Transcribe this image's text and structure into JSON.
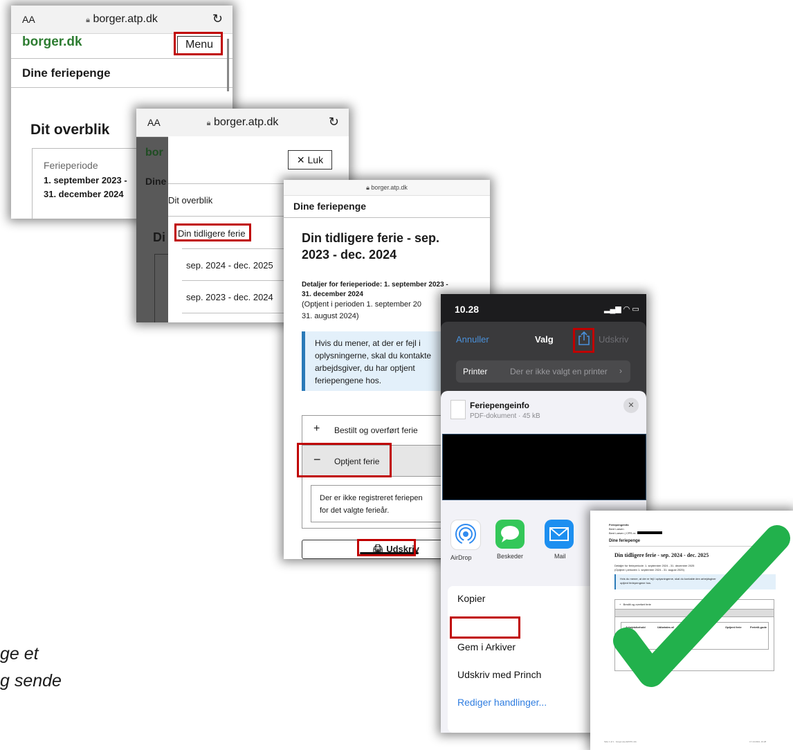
{
  "caption": {
    "line1": "ge et",
    "line2": "g sende"
  },
  "colors": {
    "highlight_border": "#c00000",
    "brand_green": "#2e7d32",
    "ios_blue": "#4a90d9",
    "check_green": "#22b14c",
    "info_blue": "#2a7ab8"
  },
  "screen1": {
    "aa": "AA",
    "host": "borger.atp.dk",
    "logo": "borger.dk",
    "menu_button": "Menu",
    "section_title": "Dine feriepenge",
    "overview_title": "Dit overblik",
    "period_label": "Ferieperiode",
    "period_line1": "1. september 2023 -",
    "period_line2": "31. december 2024"
  },
  "screen2": {
    "aa": "AA",
    "host": "borger.atp.dk",
    "bg_logo": "bor",
    "bg_nav": "Dine",
    "bg_heading": "Di",
    "close_button": "Luk",
    "menu_items": [
      "Dit overblik",
      "Din tidligere ferie",
      "sep. 2024 - dec. 2025",
      "sep. 2023 - dec. 2024"
    ]
  },
  "screen3": {
    "host": "borger.atp.dk",
    "section_title": "Dine feriepenge",
    "heading_line1": "Din tidligere ferie - sep.",
    "heading_line2": "2023 - dec. 2024",
    "details_line1": "Detaljer for ferieperiode: 1. september 2023 -",
    "details_line2": "31. december 2024",
    "earned_line1": "(Optjent i perioden 1. september 20",
    "earned_line2": "31. august 2024)",
    "info_lines": [
      "Hvis du mener, at der er fejl i",
      "oplysningerne, skal du kontakte",
      "arbejdsgiver, du har optjent",
      "feriepengene hos."
    ],
    "accordion1": "Bestilt og overført ferie",
    "accordion2": "Optjent ferie",
    "empty_line1": "Der er ikke registreret feriepen",
    "empty_line2": "for det valgte ferieår.",
    "print_button": "Udskriv"
  },
  "screen4": {
    "time": "10.28",
    "cancel": "Annuller",
    "title": "Valg",
    "print": "Udskriv",
    "printer_label": "Printer",
    "printer_value": "Der er ikke valgt en printer",
    "doc_title": "Feriepengeinfo",
    "doc_subtitle": "PDF-dokument · 45 kB",
    "apps": [
      "AirDrop",
      "Beskeder",
      "Mail"
    ],
    "actions": [
      "Kopier",
      "Gem i Arkiver",
      "Udskriv med Princh"
    ],
    "edit_actions": "Rediger handlinger..."
  },
  "screen5": {
    "header_line1": "Feriepengeinfo",
    "header_line2": "Bent Larsen",
    "header_line3": "Bent Larsen | CPR-nr.:",
    "section_title": "Dine feriepenge",
    "heading": "Din tidligere ferie - sep. 2024 - dec. 2025",
    "details_line1": "Detaljer for ferieperiode: 1. september 2024 - 31. december 2025",
    "details_line2": "(Optjent i perioden 1. september 2024 - 31. august 2025)",
    "info_line1": "Hvis du mener, at der er fejl i oplysningerne, skal du kontakte den arbejdsgiver",
    "info_line2": "optjent feriepengene hos.",
    "accordion1": "Bestilt og overført ferie",
    "col_headers": [
      "Arbejdsforhold",
      "Udbetales af",
      "Optjent ferie",
      "Optjent ferie",
      "Ferietil-gode"
    ],
    "footer_left": "Side 1 af 1 · borger.atp.dk/FPK-info",
    "footer_right": "17.10.2024, 10.28"
  }
}
